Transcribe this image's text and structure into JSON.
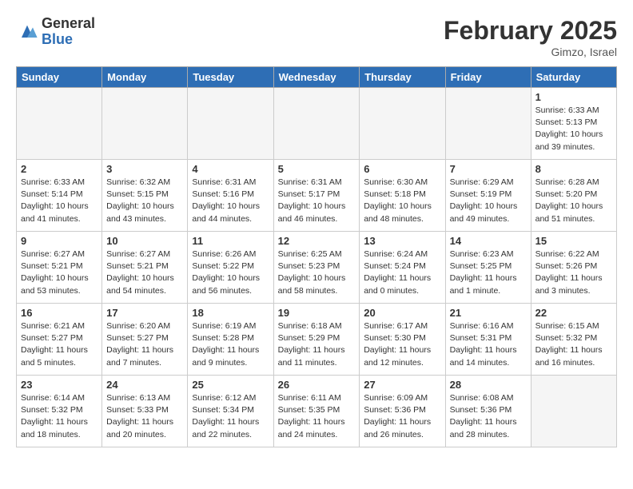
{
  "header": {
    "logo_general": "General",
    "logo_blue": "Blue",
    "month_title": "February 2025",
    "subtitle": "Gimzo, Israel"
  },
  "days_of_week": [
    "Sunday",
    "Monday",
    "Tuesday",
    "Wednesday",
    "Thursday",
    "Friday",
    "Saturday"
  ],
  "weeks": [
    [
      {
        "day": "",
        "empty": true
      },
      {
        "day": "",
        "empty": true
      },
      {
        "day": "",
        "empty": true
      },
      {
        "day": "",
        "empty": true
      },
      {
        "day": "",
        "empty": true
      },
      {
        "day": "",
        "empty": true
      },
      {
        "day": "1",
        "sunrise": "6:33 AM",
        "sunset": "5:13 PM",
        "daylight": "10 hours and 39 minutes."
      }
    ],
    [
      {
        "day": "2",
        "sunrise": "6:33 AM",
        "sunset": "5:14 PM",
        "daylight": "10 hours and 41 minutes."
      },
      {
        "day": "3",
        "sunrise": "6:32 AM",
        "sunset": "5:15 PM",
        "daylight": "10 hours and 43 minutes."
      },
      {
        "day": "4",
        "sunrise": "6:31 AM",
        "sunset": "5:16 PM",
        "daylight": "10 hours and 44 minutes."
      },
      {
        "day": "5",
        "sunrise": "6:31 AM",
        "sunset": "5:17 PM",
        "daylight": "10 hours and 46 minutes."
      },
      {
        "day": "6",
        "sunrise": "6:30 AM",
        "sunset": "5:18 PM",
        "daylight": "10 hours and 48 minutes."
      },
      {
        "day": "7",
        "sunrise": "6:29 AM",
        "sunset": "5:19 PM",
        "daylight": "10 hours and 49 minutes."
      },
      {
        "day": "8",
        "sunrise": "6:28 AM",
        "sunset": "5:20 PM",
        "daylight": "10 hours and 51 minutes."
      }
    ],
    [
      {
        "day": "9",
        "sunrise": "6:27 AM",
        "sunset": "5:21 PM",
        "daylight": "10 hours and 53 minutes."
      },
      {
        "day": "10",
        "sunrise": "6:27 AM",
        "sunset": "5:21 PM",
        "daylight": "10 hours and 54 minutes."
      },
      {
        "day": "11",
        "sunrise": "6:26 AM",
        "sunset": "5:22 PM",
        "daylight": "10 hours and 56 minutes."
      },
      {
        "day": "12",
        "sunrise": "6:25 AM",
        "sunset": "5:23 PM",
        "daylight": "10 hours and 58 minutes."
      },
      {
        "day": "13",
        "sunrise": "6:24 AM",
        "sunset": "5:24 PM",
        "daylight": "11 hours and 0 minutes."
      },
      {
        "day": "14",
        "sunrise": "6:23 AM",
        "sunset": "5:25 PM",
        "daylight": "11 hours and 1 minute."
      },
      {
        "day": "15",
        "sunrise": "6:22 AM",
        "sunset": "5:26 PM",
        "daylight": "11 hours and 3 minutes."
      }
    ],
    [
      {
        "day": "16",
        "sunrise": "6:21 AM",
        "sunset": "5:27 PM",
        "daylight": "11 hours and 5 minutes."
      },
      {
        "day": "17",
        "sunrise": "6:20 AM",
        "sunset": "5:27 PM",
        "daylight": "11 hours and 7 minutes."
      },
      {
        "day": "18",
        "sunrise": "6:19 AM",
        "sunset": "5:28 PM",
        "daylight": "11 hours and 9 minutes."
      },
      {
        "day": "19",
        "sunrise": "6:18 AM",
        "sunset": "5:29 PM",
        "daylight": "11 hours and 11 minutes."
      },
      {
        "day": "20",
        "sunrise": "6:17 AM",
        "sunset": "5:30 PM",
        "daylight": "11 hours and 12 minutes."
      },
      {
        "day": "21",
        "sunrise": "6:16 AM",
        "sunset": "5:31 PM",
        "daylight": "11 hours and 14 minutes."
      },
      {
        "day": "22",
        "sunrise": "6:15 AM",
        "sunset": "5:32 PM",
        "daylight": "11 hours and 16 minutes."
      }
    ],
    [
      {
        "day": "23",
        "sunrise": "6:14 AM",
        "sunset": "5:32 PM",
        "daylight": "11 hours and 18 minutes."
      },
      {
        "day": "24",
        "sunrise": "6:13 AM",
        "sunset": "5:33 PM",
        "daylight": "11 hours and 20 minutes."
      },
      {
        "day": "25",
        "sunrise": "6:12 AM",
        "sunset": "5:34 PM",
        "daylight": "11 hours and 22 minutes."
      },
      {
        "day": "26",
        "sunrise": "6:11 AM",
        "sunset": "5:35 PM",
        "daylight": "11 hours and 24 minutes."
      },
      {
        "day": "27",
        "sunrise": "6:09 AM",
        "sunset": "5:36 PM",
        "daylight": "11 hours and 26 minutes."
      },
      {
        "day": "28",
        "sunrise": "6:08 AM",
        "sunset": "5:36 PM",
        "daylight": "11 hours and 28 minutes."
      },
      {
        "day": "",
        "empty": true
      }
    ]
  ]
}
